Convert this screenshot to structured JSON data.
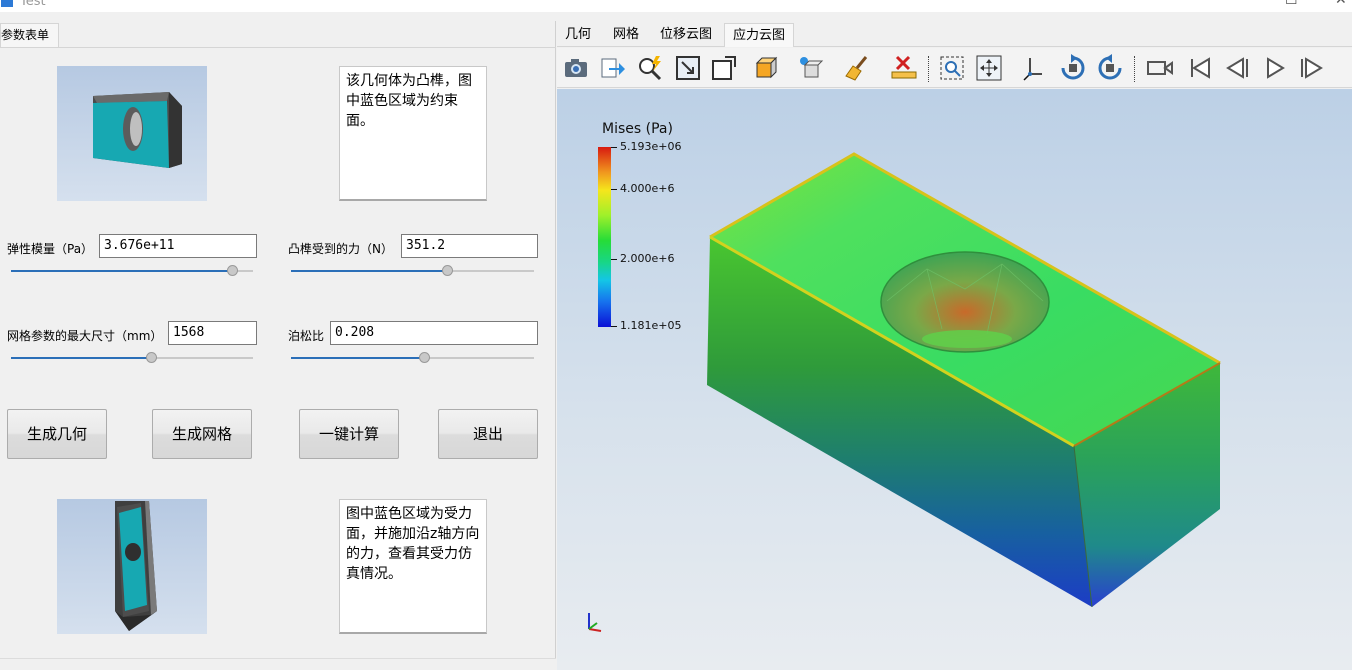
{
  "window": {
    "title": "Test"
  },
  "left_panel": {
    "tab_label": "参数表单",
    "top_note": "该几何体为凸榫，图中蓝色区域为约束面。",
    "bottom_note": "图中蓝色区域为受力面，并施加沿z轴方向的力，查看其受力仿真情况。",
    "params": {
      "elastic_modulus": {
        "label": "弹性模量（Pa）",
        "value": "3.676e+11",
        "slider_fraction": 0.9
      },
      "force": {
        "label": "凸榫受到的力（N）",
        "value": "351.2",
        "slider_fraction": 0.63
      },
      "mesh_max_size": {
        "label": "网格参数的最大尺寸（mm）",
        "value": "1568",
        "slider_fraction": 0.58
      },
      "poisson_ratio": {
        "label": "泊松比",
        "value": "0.208",
        "slider_fraction": 0.55
      }
    },
    "buttons": {
      "gen_geometry": "生成几何",
      "gen_mesh": "生成网格",
      "compute": "一键计算",
      "exit": "退出"
    }
  },
  "right_panel": {
    "tabs": [
      "几何",
      "网格",
      "位移云图",
      "应力云图"
    ],
    "active_tab": "应力云图",
    "toolbar_icons": [
      "camera-icon",
      "export-icon",
      "zoom-lightning-icon",
      "zoom-box-icon",
      "frame-icon",
      "view-cube-icon",
      "view-cube-dropdown-icon",
      "broom-icon",
      "ruler-delete-icon",
      "zoom-region-icon",
      "pan-icon",
      "axis-icon",
      "rotate-cw-icon",
      "rotate-ccw-icon",
      "video-camera-icon",
      "skip-first-icon",
      "step-back-icon",
      "play-icon",
      "skip-last-icon"
    ],
    "legend": {
      "title": "Mises (Pa)",
      "max_label": "5.193e+06",
      "tick_4": "4.000e+6",
      "tick_2": "2.000e+6",
      "min_label": "1.181e+05"
    }
  }
}
